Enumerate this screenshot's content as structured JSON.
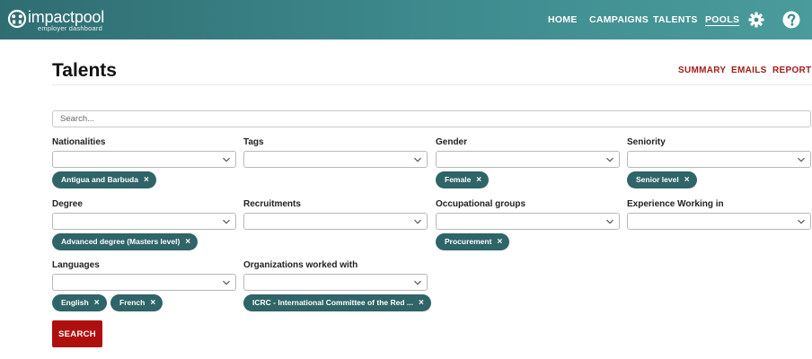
{
  "brand": {
    "name": "impactpool",
    "subtitle": "employer dashboard"
  },
  "nav": {
    "items": [
      {
        "label": "HOME"
      },
      {
        "label": "CAMPAIGNS"
      },
      {
        "label": "TALENTS"
      },
      {
        "label": "POOLS",
        "active": true
      }
    ],
    "icons": [
      "gear-icon",
      "help-icon"
    ]
  },
  "page": {
    "title": "Talents",
    "links": [
      "SUMMARY",
      "EMAILS",
      "REPORT"
    ]
  },
  "search": {
    "placeholder": "Search...",
    "value": ""
  },
  "filters": [
    {
      "label": "Nationalities",
      "chips": [
        "Antigua and Barbuda"
      ]
    },
    {
      "label": "Tags",
      "chips": []
    },
    {
      "label": "Gender",
      "chips": [
        "Female"
      ]
    },
    {
      "label": "Seniority",
      "chips": [
        "Senior level"
      ]
    },
    {
      "label": "Degree",
      "chips": [
        "Advanced degree (Masters level)"
      ]
    },
    {
      "label": "Recruitments",
      "chips": []
    },
    {
      "label": "Occupational groups",
      "chips": [
        "Procurement"
      ]
    },
    {
      "label": "Experience Working in",
      "chips": []
    },
    {
      "label": "Languages",
      "chips": [
        "English",
        "French"
      ]
    },
    {
      "label": "Organizations worked with",
      "chips": [
        "ICRC - International Committee of the Red ..."
      ]
    }
  ],
  "chip_remove_glyph": "×",
  "actions": {
    "search_label": "SEARCH"
  },
  "colors": {
    "header": "#3e8b8e",
    "chip": "#2f6468",
    "accent_link": "#a61b1b",
    "primary_button": "#b00f10"
  }
}
